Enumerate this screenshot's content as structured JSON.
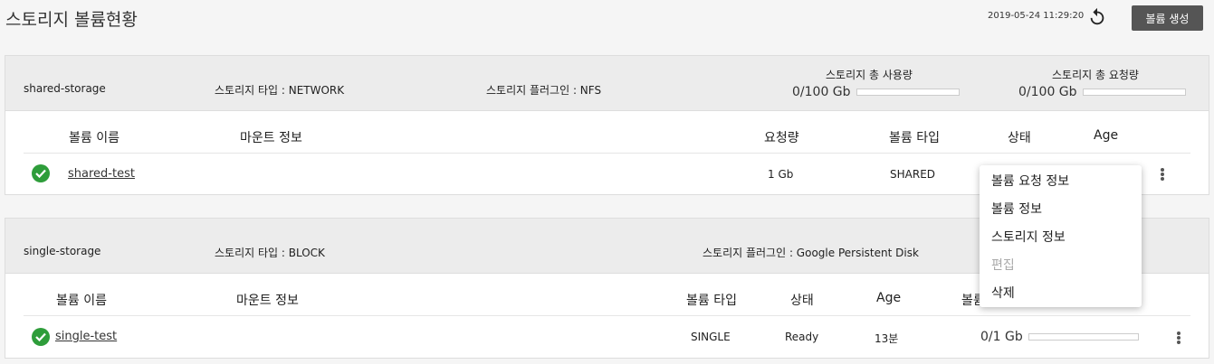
{
  "page": {
    "title": "스토리지 볼륨현황",
    "timestamp": "2019-05-24 11:29:20",
    "create_button": "볼륨 생성"
  },
  "storages": [
    {
      "name": "shared-storage",
      "type": "스토리지 타입 : NETWORK",
      "plugin": "스토리지 플러그인 : NFS",
      "usage_title": "스토리지 총 사용량",
      "usage_value": "0/100 Gb",
      "usage_fraction": 0,
      "request_title": "스토리지 총 요청량",
      "request_value": "0/100 Gb",
      "request_fraction": 0,
      "columns": {
        "name": "볼륨 이름",
        "mount": "마운트 정보",
        "request": "요청량",
        "type": "볼륨 타입",
        "status": "상태",
        "age": "Age"
      },
      "rows": [
        {
          "name": "shared-test",
          "request": "1 Gb",
          "type": "SHARED"
        }
      ]
    },
    {
      "name": "single-storage",
      "type": "스토리지 타입 : BLOCK",
      "plugin": "스토리지 플러그인 : Google Persistent Disk",
      "columns": {
        "name": "볼륨 이름",
        "mount": "마운트 정보",
        "type": "볼륨 타입",
        "status": "상태",
        "age": "Age",
        "usage": "볼륨"
      },
      "rows": [
        {
          "name": "single-test",
          "type": "SINGLE",
          "status": "Ready",
          "age": "13분",
          "usage": "0/1 Gb",
          "usage_fraction": 0
        }
      ]
    }
  ],
  "context_menu": {
    "items": [
      {
        "label": "볼륨 요청 정보",
        "enabled": true
      },
      {
        "label": "볼륨 정보",
        "enabled": true
      },
      {
        "label": "스토리지 정보",
        "enabled": true
      },
      {
        "label": "편집",
        "enabled": false
      },
      {
        "label": "삭제",
        "enabled": true
      }
    ]
  },
  "icons": {
    "refresh": "refresh-icon",
    "status": "check-circle-icon",
    "more": "more-vert-icon"
  },
  "colors": {
    "status_ok": "#2e9d3a",
    "primary_button": "#555555",
    "header_bg": "#ececec"
  }
}
